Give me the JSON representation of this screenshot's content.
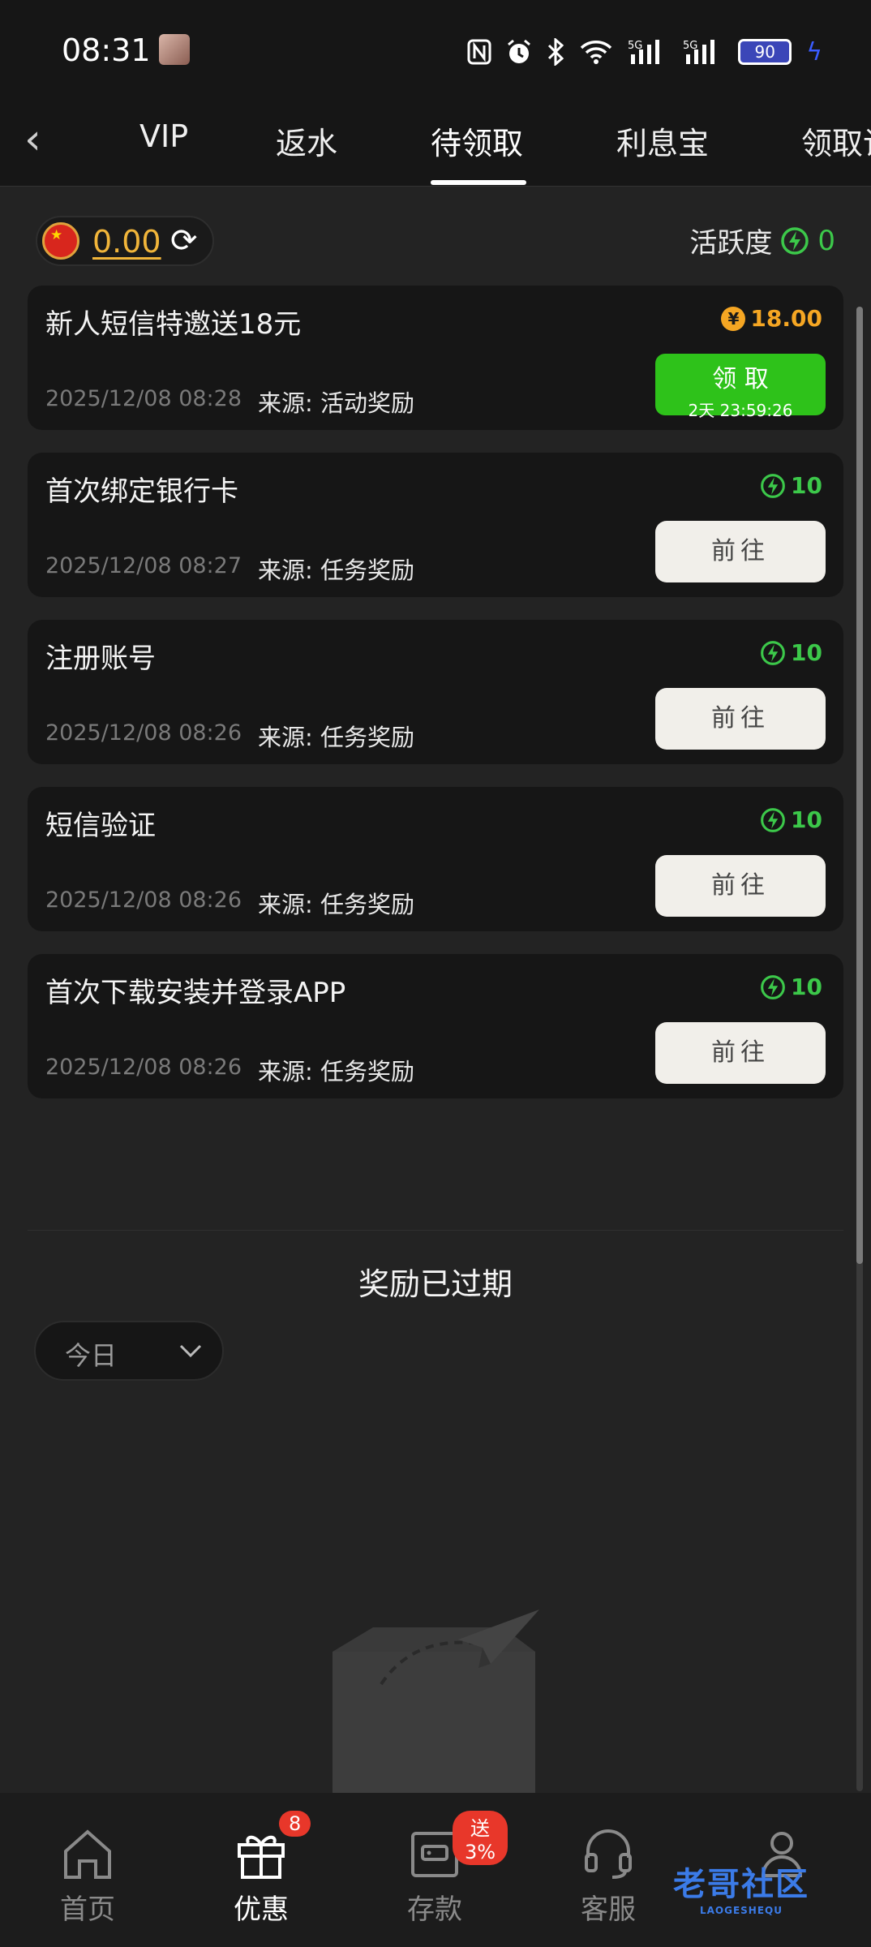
{
  "status_bar": {
    "time": "08:31",
    "icons": [
      "nfc-icon",
      "alarm-icon",
      "bluetooth-icon",
      "wifi-icon",
      "signal-5g-icon",
      "signal-5g-icon"
    ],
    "network_label_1": "5G",
    "network_label_2": "5G",
    "battery": "90"
  },
  "nav": {
    "tabs": [
      {
        "label": "VIP"
      },
      {
        "label": "返水"
      },
      {
        "label": "待领取",
        "active": true
      },
      {
        "label": "利息宝"
      },
      {
        "label": "领取记"
      }
    ]
  },
  "balance": {
    "value": "0.00"
  },
  "activity": {
    "label": "活跃度",
    "value": "0"
  },
  "rewards": [
    {
      "title": "新人短信特邀送18元",
      "amount": "18.00",
      "amount_type": "money",
      "date": "2025/12/08 08:28",
      "source": "来源: 活动奖励",
      "button": "领 取",
      "countdown": "2天 23:59:26"
    },
    {
      "title": "首次绑定银行卡",
      "amount": "10",
      "amount_type": "energy",
      "date": "2025/12/08 08:27",
      "source": "来源: 任务奖励",
      "button": "前往"
    },
    {
      "title": "注册账号",
      "amount": "10",
      "amount_type": "energy",
      "date": "2025/12/08 08:26",
      "source": "来源: 任务奖励",
      "button": "前往"
    },
    {
      "title": "短信验证",
      "amount": "10",
      "amount_type": "energy",
      "date": "2025/12/08 08:26",
      "source": "来源: 任务奖励",
      "button": "前往"
    },
    {
      "title": "首次下载安装并登录APP",
      "amount": "10",
      "amount_type": "energy",
      "date": "2025/12/08 08:26",
      "source": "来源: 任务奖励",
      "button": "前往"
    }
  ],
  "expired": {
    "title": "奖励已过期",
    "filter_label": "今日"
  },
  "bottom_nav": {
    "items": [
      {
        "label": "首页",
        "icon": "home-icon"
      },
      {
        "label": "优惠",
        "icon": "gift-icon",
        "badge": "8",
        "active": true
      },
      {
        "label": "存款",
        "icon": "wallet-icon",
        "badge": "送3%"
      },
      {
        "label": "客服",
        "icon": "headset-icon"
      },
      {
        "label": "",
        "icon": "user-icon"
      }
    ]
  },
  "watermark": {
    "text": "老哥社区",
    "sub": "LAOGESHEQU"
  },
  "colors": {
    "accent_green": "#2ec21a",
    "energy_green": "#3cc84a",
    "money_gold": "#f5a623",
    "badge_red": "#e8372a"
  }
}
